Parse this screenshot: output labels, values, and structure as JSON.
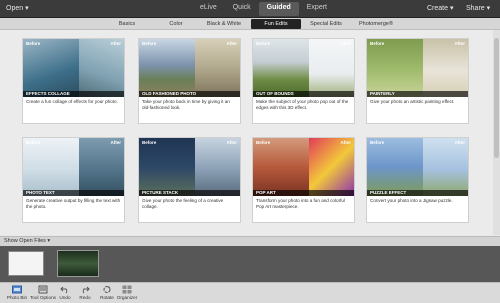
{
  "topbar": {
    "open_label": "Open ▾",
    "modes": [
      "eLive",
      "Quick",
      "Guided",
      "Expert"
    ],
    "active_mode": "Guided",
    "create_label": "Create ▾",
    "share_label": "Share ▾"
  },
  "tabs": [
    {
      "label": "Basics"
    },
    {
      "label": "Color"
    },
    {
      "label": "Black & White"
    },
    {
      "label": "Fun Edits",
      "active": true
    },
    {
      "label": "Special Edits"
    },
    {
      "label": "Photomerge®"
    }
  ],
  "badges": {
    "before": "Before",
    "after": "After"
  },
  "cards": [
    {
      "title": "EFFECTS COLLAGE",
      "desc": "Create a fun collage of effects for your photo.",
      "colors": [
        "#3d6f8a",
        "#7fa1b1"
      ]
    },
    {
      "title": "OLD FASHIONED PHOTO",
      "desc": "Take your photo back in time by giving it an old-fashioned look.",
      "colors": [
        "#7d93ad",
        "#b1a98d"
      ]
    },
    {
      "title": "OUT OF BOUNDS",
      "desc": "Make the subject of your photo pop out of the edges with this 3D effect.",
      "colors": [
        "#6f8c45",
        "#e9edf0"
      ]
    },
    {
      "title": "PAINTERLY",
      "desc": "Give your photo an artistic painting effect.",
      "colors": [
        "#9db96a",
        "#e8e4d8"
      ]
    },
    {
      "title": "PHOTO TEXT",
      "desc": "Generate creative output by filling the text with the photo.",
      "colors": [
        "#cfdde6",
        "#4f7086"
      ]
    },
    {
      "title": "PICTURE STACK",
      "desc": "Give your photo the feeling of a creative collage.",
      "colors": [
        "#2d4767",
        "#8a9fb5"
      ]
    },
    {
      "title": "POP ART",
      "desc": "Transform your photo into a fun and colorful Pop Art masterpiece.",
      "colors": [
        "#b75a3b",
        "#f2c83a"
      ]
    },
    {
      "title": "PUZZLE EFFECT",
      "desc": "Convert your photo into a Jigsaw puzzle.",
      "colors": [
        "#6c96c9",
        "#a5c1df"
      ]
    }
  ],
  "bin": {
    "label": "Show Open Files ▾"
  },
  "bottombar": [
    {
      "label": "Photo Bin",
      "icon": "photo-bin-icon"
    },
    {
      "label": "Tool Options",
      "icon": "tool-options-icon"
    },
    {
      "label": "Undo",
      "icon": "undo-icon"
    },
    {
      "label": "Redo",
      "icon": "redo-icon"
    },
    {
      "label": "Rotate",
      "icon": "rotate-icon"
    },
    {
      "label": "Organizer",
      "icon": "organizer-icon"
    }
  ]
}
